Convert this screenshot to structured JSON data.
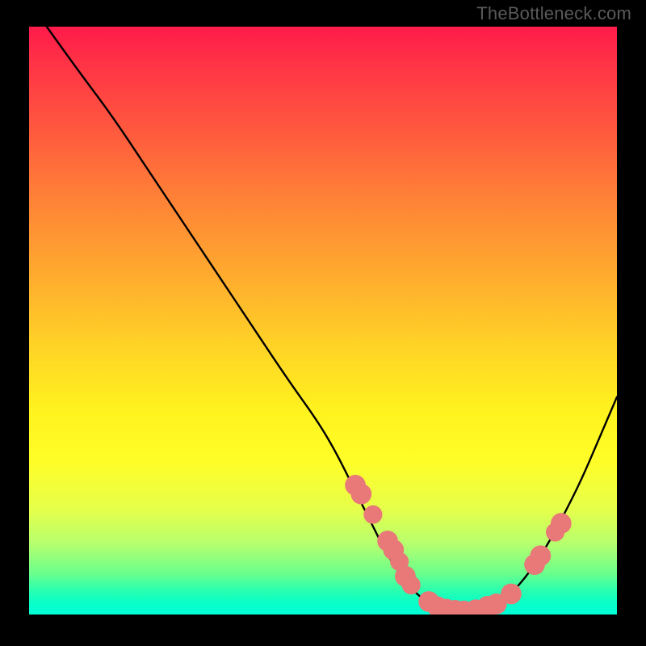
{
  "watermark": "TheBottleneck.com",
  "chart_data": {
    "type": "line",
    "title": "",
    "xlabel": "",
    "ylabel": "",
    "xlim": [
      0,
      100
    ],
    "ylim": [
      0,
      100
    ],
    "grid": false,
    "legend": false,
    "series": [
      {
        "name": "curve",
        "x": [
          3,
          8,
          14,
          20,
          26,
          32,
          38,
          44,
          49,
          52,
          55,
          58,
          61,
          64,
          67,
          70,
          73,
          76,
          79,
          82,
          85,
          88,
          91,
          94,
          97,
          100
        ],
        "y": [
          100,
          93,
          85,
          76,
          67,
          58,
          49,
          40,
          33,
          28,
          22,
          16,
          10,
          5.5,
          2.5,
          1,
          0.5,
          0.7,
          1.5,
          3.5,
          7,
          11.5,
          17,
          23,
          30,
          37
        ],
        "color": "#000000"
      }
    ],
    "markers": [
      {
        "x": 55.5,
        "y": 22,
        "r": 1.2
      },
      {
        "x": 56.5,
        "y": 20.5,
        "r": 1.2
      },
      {
        "x": 58.5,
        "y": 17,
        "r": 1.0
      },
      {
        "x": 61,
        "y": 12.5,
        "r": 1.2
      },
      {
        "x": 62,
        "y": 11,
        "r": 1.2
      },
      {
        "x": 63,
        "y": 9,
        "r": 1.0
      },
      {
        "x": 64,
        "y": 6.5,
        "r": 1.2
      },
      {
        "x": 65,
        "y": 5,
        "r": 1.0
      },
      {
        "x": 68,
        "y": 2.2,
        "r": 1.2
      },
      {
        "x": 69.5,
        "y": 1.3,
        "r": 1.2
      },
      {
        "x": 71,
        "y": 0.9,
        "r": 1.2
      },
      {
        "x": 72.5,
        "y": 0.7,
        "r": 1.2
      },
      {
        "x": 74,
        "y": 0.6,
        "r": 1.2
      },
      {
        "x": 76,
        "y": 0.8,
        "r": 1.2
      },
      {
        "x": 78,
        "y": 1.3,
        "r": 1.3
      },
      {
        "x": 79.5,
        "y": 1.8,
        "r": 1.2
      },
      {
        "x": 82,
        "y": 3.5,
        "r": 1.2
      },
      {
        "x": 86,
        "y": 8.5,
        "r": 1.2
      },
      {
        "x": 87,
        "y": 10,
        "r": 1.2
      },
      {
        "x": 89.5,
        "y": 14,
        "r": 1.0
      },
      {
        "x": 90.5,
        "y": 15.5,
        "r": 1.2
      }
    ],
    "marker_color": "#e97878",
    "gradient_colors": {
      "top": "#ff1a4a",
      "mid": "#fff41e",
      "bottom": "#00ffd6"
    }
  }
}
